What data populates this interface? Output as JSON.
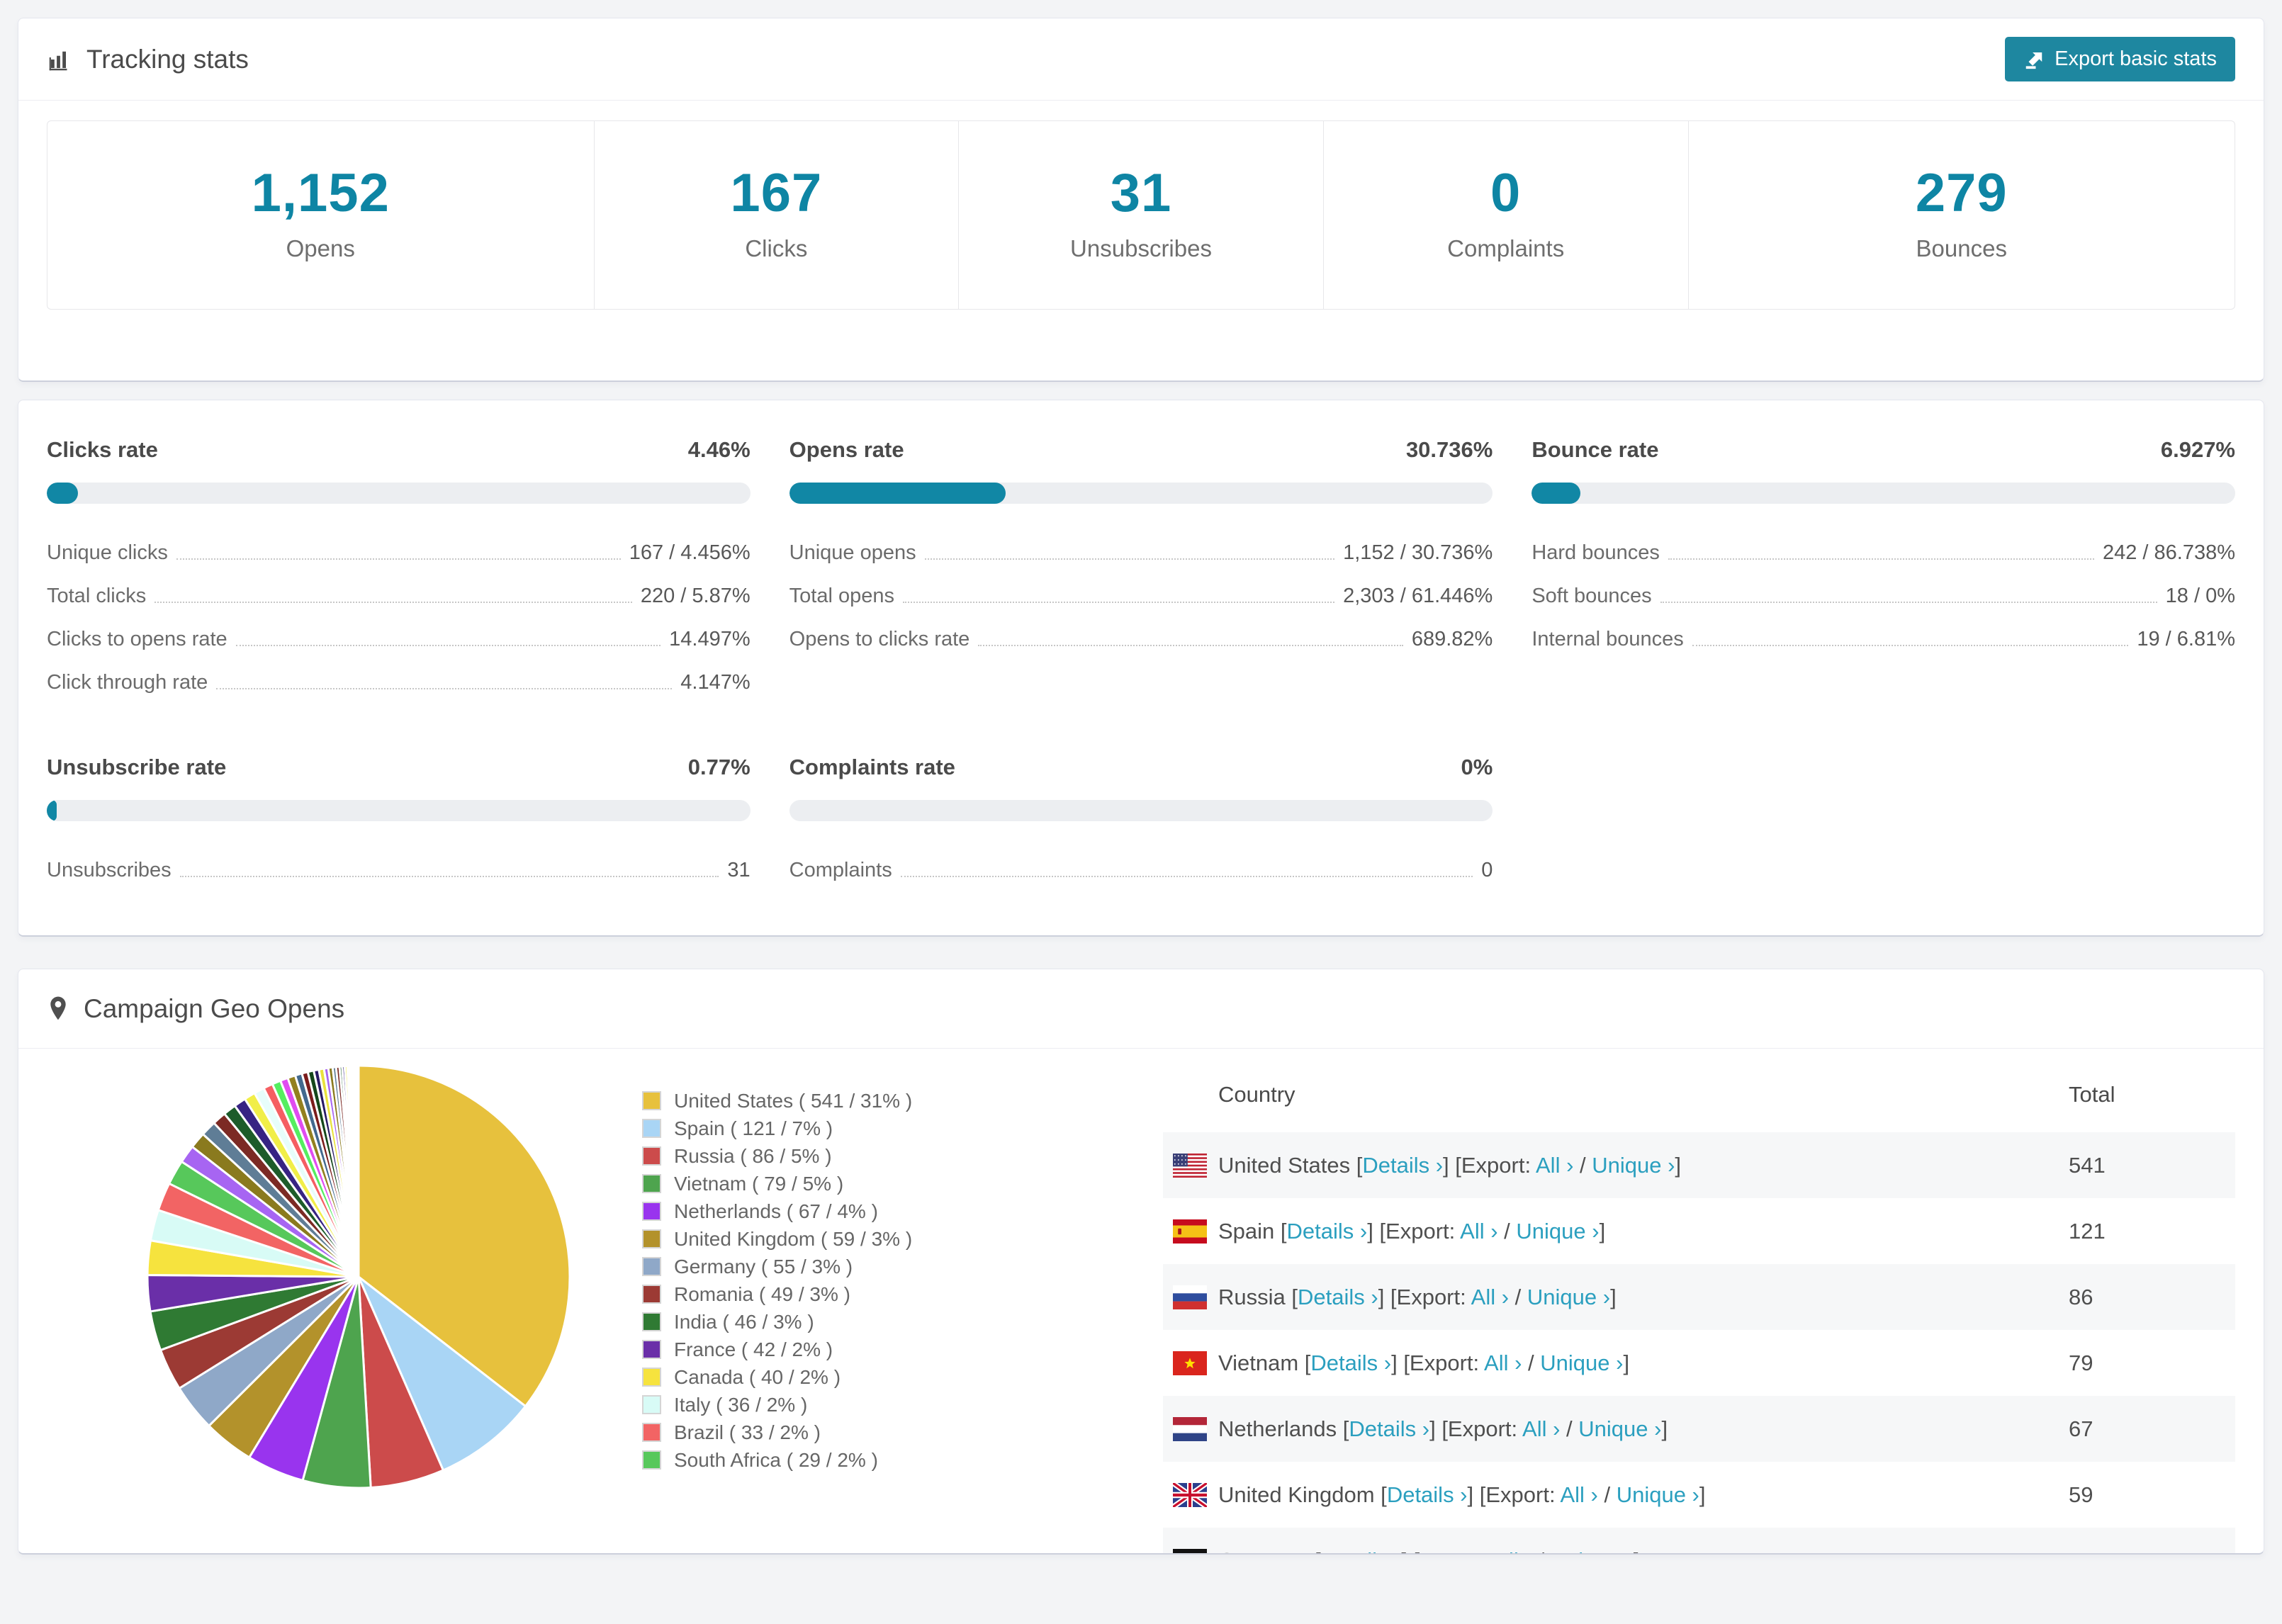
{
  "colors": {
    "accent": "#0e85a4",
    "link": "#2b9fbf",
    "bar_track": "#eceef0",
    "bar_fill": "#1187a5"
  },
  "tracking": {
    "title": "Tracking stats",
    "export_button": "Export basic stats",
    "stats": [
      {
        "value": "1,152",
        "label": "Opens"
      },
      {
        "value": "167",
        "label": "Clicks"
      },
      {
        "value": "31",
        "label": "Unsubscribes"
      },
      {
        "value": "0",
        "label": "Complaints"
      },
      {
        "value": "279",
        "label": "Bounces"
      }
    ]
  },
  "rates": [
    {
      "title": "Clicks rate",
      "value": "4.46%",
      "percent": 4.46,
      "rows": [
        {
          "label": "Unique clicks",
          "value": "167 / 4.456%"
        },
        {
          "label": "Total clicks",
          "value": "220 / 5.87%"
        },
        {
          "label": "Clicks to opens rate",
          "value": "14.497%"
        },
        {
          "label": "Click through rate",
          "value": "4.147%"
        }
      ]
    },
    {
      "title": "Opens rate",
      "value": "30.736%",
      "percent": 30.736,
      "rows": [
        {
          "label": "Unique opens",
          "value": "1,152 / 30.736%"
        },
        {
          "label": "Total opens",
          "value": "2,303 / 61.446%"
        },
        {
          "label": "Opens to clicks rate",
          "value": "689.82%"
        }
      ]
    },
    {
      "title": "Bounce rate",
      "value": "6.927%",
      "percent": 6.927,
      "rows": [
        {
          "label": "Hard bounces",
          "value": "242 / 86.738%"
        },
        {
          "label": "Soft bounces",
          "value": "18 / 0%"
        },
        {
          "label": "Internal bounces",
          "value": "19 / 6.81%"
        }
      ]
    },
    {
      "title": "Unsubscribe rate",
      "value": "0.77%",
      "percent": 0.77,
      "rows": [
        {
          "label": "Unsubscribes",
          "value": "31"
        }
      ]
    },
    {
      "title": "Complaints rate",
      "value": "0%",
      "percent": 0,
      "rows": [
        {
          "label": "Complaints",
          "value": "0"
        }
      ]
    }
  ],
  "geo": {
    "title": "Campaign Geo Opens",
    "chart_data": {
      "type": "pie",
      "title": "Campaign Geo Opens",
      "labels": [
        "United States",
        "Spain",
        "Russia",
        "Vietnam",
        "Netherlands",
        "United Kingdom",
        "Germany",
        "Romania",
        "India",
        "France",
        "Canada",
        "Italy",
        "Brazil",
        "South Africa"
      ],
      "values": [
        541,
        121,
        86,
        79,
        67,
        59,
        55,
        49,
        46,
        42,
        40,
        36,
        33,
        29
      ],
      "percent_labels": [
        "31%",
        "7%",
        "5%",
        "5%",
        "4%",
        "3%",
        "3%",
        "3%",
        "3%",
        "2%",
        "2%",
        "2%",
        "2%",
        "2%"
      ],
      "colors": [
        "#e7c13d",
        "#a9d5f5",
        "#cc4b4b",
        "#4ea44e",
        "#9934ee",
        "#b3922b",
        "#8fa8c8",
        "#9c3a34",
        "#2f7a33",
        "#6a2fa8",
        "#f6e33e",
        "#d8fbf6",
        "#f26464",
        "#57c85b"
      ],
      "unlabeled_tail_values": [
        21,
        19,
        18,
        16,
        15,
        14,
        13,
        12,
        11,
        10,
        9,
        9,
        8,
        7,
        7,
        6,
        6,
        5,
        5,
        4,
        4,
        3,
        3,
        3,
        2,
        2,
        2,
        2,
        1,
        1,
        1,
        1,
        1
      ],
      "tail_colors": [
        "#a765f2",
        "#8a7a1e",
        "#5f7d96",
        "#7c2a24",
        "#1d5c2a",
        "#372383",
        "#f1ee48",
        "#e7fdfb",
        "#f55e62",
        "#55ee60",
        "#e04cf1",
        "#93801f",
        "#42698e",
        "#7b1c1c",
        "#15471a",
        "#281a64",
        "#e9e13c"
      ],
      "legend_position": "right",
      "start_angle_deg": -90,
      "direction": "clockwise"
    },
    "table": {
      "columns": [
        "Country",
        "Total"
      ],
      "details_label": "Details ›",
      "export_prefix": "[Export:",
      "all_label": "All ›",
      "unique_label": "Unique ›",
      "rows": [
        {
          "flag": "us",
          "country": "United States",
          "total": "541"
        },
        {
          "flag": "es",
          "country": "Spain",
          "total": "121"
        },
        {
          "flag": "ru",
          "country": "Russia",
          "total": "86"
        },
        {
          "flag": "vn",
          "country": "Vietnam",
          "total": "79"
        },
        {
          "flag": "nl",
          "country": "Netherlands",
          "total": "67"
        },
        {
          "flag": "gb",
          "country": "United Kingdom",
          "total": "59"
        },
        {
          "flag": "de",
          "country": "Germany",
          "total": "",
          "partial": true
        }
      ]
    }
  }
}
